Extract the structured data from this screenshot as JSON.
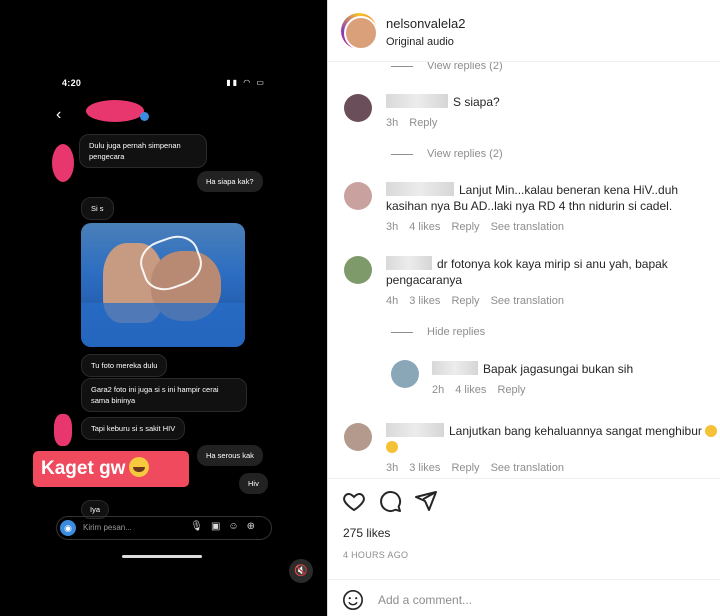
{
  "left": {
    "status_time": "4:20",
    "messages": {
      "m1": "Dulu juga pernah simpenan pengecara",
      "m2": "Ha siapa kak?",
      "m3": "Si s",
      "m4": "Tu foto mereka dulu",
      "m5": "Gara2 foto ini juga si s ini hampir cerai sama bininya",
      "m6": "Tapi keburu si s sakit HIV",
      "m7": "Ha serous kak",
      "m8": "Hiv",
      "m9": "Iya"
    },
    "sticker": "Kaget gw",
    "composer_placeholder": "Kirim pesan..."
  },
  "post": {
    "username": "nelsonvalela2",
    "audio": "Original audio"
  },
  "comments": {
    "view_replies_top": "View replies (2)",
    "c1": {
      "text": "S siapa?",
      "time": "3h",
      "reply": "Reply"
    },
    "view_replies_c1": "View replies (2)",
    "c2": {
      "text": "Lanjut Min...kalau beneran kena HiV..duh kasihan nya Bu AD..laki nya RD 4 thn nidurin si cadel.",
      "time": "3h",
      "likes": "4 likes",
      "reply": "Reply",
      "translate": "See translation"
    },
    "c3": {
      "text": "dr fotonya kok kaya mirip si anu yah, bapak pengacaranya",
      "time": "4h",
      "likes": "3 likes",
      "reply": "Reply",
      "translate": "See translation"
    },
    "hide_replies": "Hide replies",
    "r1": {
      "text": "Bapak jagasungai bukan sih",
      "time": "2h",
      "likes": "4 likes",
      "reply": "Reply"
    },
    "c4": {
      "text": "Lanjutkan bang kehaluannya sangat menghibur",
      "time": "3h",
      "likes": "3 likes",
      "reply": "Reply",
      "translate": "See translation"
    }
  },
  "footer": {
    "likes": "275 likes",
    "ago": "4 HOURS AGO",
    "add_comment": "Add a comment..."
  },
  "colors": {
    "sticker_bg": "#f04a5e",
    "link": "#8e8e8e",
    "accent": "#3a8dde"
  }
}
